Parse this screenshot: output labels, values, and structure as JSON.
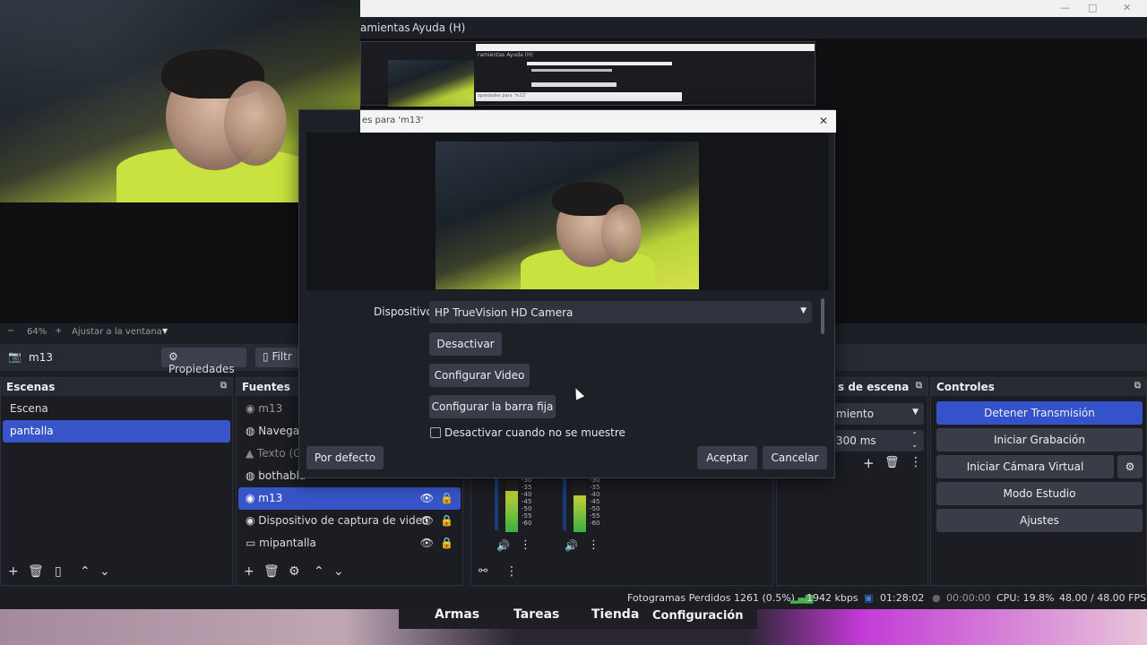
{
  "window": {
    "minimize": "—",
    "maximize": "□",
    "close": "✕",
    "menu": [
      "amientas",
      "Ayuda (H)"
    ]
  },
  "zoom": {
    "minus": "−",
    "value": "64%",
    "plus": "+",
    "fit": "Ajustar a la ventana",
    "caret": "▼"
  },
  "source_toolbar": {
    "selected_source": "m13",
    "properties": "Propiedades",
    "filters": "Filtr"
  },
  "scenes": {
    "title": "Escenas",
    "items": [
      {
        "label": "Escena",
        "selected": false
      },
      {
        "label": "pantalla",
        "selected": true
      }
    ]
  },
  "sources": {
    "title": "Fuentes",
    "items": [
      {
        "label": "m13",
        "icon": "camera-icon"
      },
      {
        "label": "Navegac",
        "icon": "globe-icon"
      },
      {
        "label": "Texto (G",
        "icon": "text-icon"
      },
      {
        "label": "bothabla",
        "icon": "globe-icon"
      },
      {
        "label": "m13",
        "icon": "camera-icon",
        "selected": true
      },
      {
        "label": "Dispositivo de captura de video",
        "icon": "camera-icon"
      },
      {
        "label": "mipantalla",
        "icon": "monitor-icon"
      }
    ]
  },
  "transitions": {
    "title": "s de escena",
    "type": "miento",
    "duration": "300 ms"
  },
  "controls": {
    "title": "Controles",
    "stop_stream": "Detener Transmisión",
    "start_recording": "Iniciar Grabación",
    "start_virtual_cam": "Iniciar Cámara Virtual",
    "studio_mode": "Modo Estudio",
    "settings": "Ajustes"
  },
  "mixer": {
    "scale_a": [
      "-30",
      "-35",
      "-40",
      "-45",
      "-50",
      "-55",
      "-60"
    ],
    "scale_b": [
      "-30",
      "-35",
      "-40",
      "-45",
      "-50",
      "-55",
      "-60"
    ],
    "level_a": 0.8,
    "level_b": 0.7
  },
  "dialog": {
    "title": "es para 'm13'",
    "close": "✕",
    "device_label": "Dispositivo",
    "device_value": "HP TrueVision HD Camera",
    "deactivate": "Desactivar",
    "configure_video": "Configurar Video",
    "configure_crossbar": "Configurar la barra fija",
    "deactivate_hidden": "Desactivar cuando no se muestre",
    "defaults": "Por defecto",
    "ok": "Aceptar",
    "cancel": "Cancelar"
  },
  "nested_preview": {
    "menu": "ramientas  Ayuda (H)",
    "dialog_title": "opiedades para 'm13'"
  },
  "status": {
    "dropped": "Fotogramas Perdidos 1261 (0.5%)",
    "bitrate": "1942 kbps",
    "stream_time": "01:28:02",
    "rec_time": "00:00:00",
    "cpu": "CPU: 19.8%",
    "fps": "48.00 / 48.00 FPS"
  },
  "game_tabs": [
    "Armas",
    "Tareas",
    "Tienda",
    "Configuración"
  ]
}
